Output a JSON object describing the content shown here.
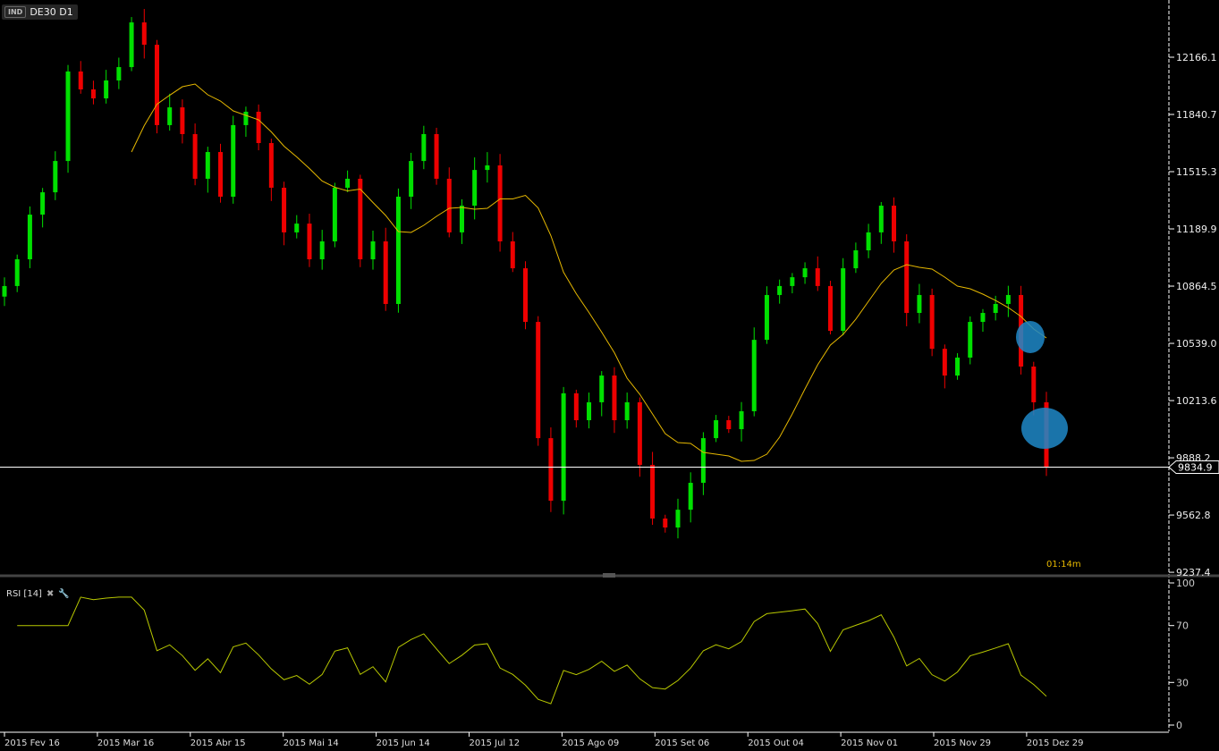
{
  "header": {
    "badge": "IND",
    "symbol": "DE30 D1"
  },
  "colors": {
    "up": "#00e000",
    "down": "#ee0000",
    "ma": "#e6b800",
    "rsi": "#b8c800",
    "annotation": "#1e88c8",
    "axis": "#ffffff"
  },
  "timer": "01:14m",
  "rsi_panel": {
    "label": "RSI [14]",
    "close_icon": "close-icon",
    "settings_icon": "wrench-icon",
    "ticks": [
      "100",
      "70",
      "30",
      "0"
    ]
  },
  "chart_data": {
    "type": "candlestick",
    "title": "DE30 D1",
    "price_ticks": [
      "12166.1",
      "11840.7",
      "11515.3",
      "11189.9",
      "10864.5",
      "10539.0",
      "10213.6",
      "9888.2",
      "9562.8",
      "9237.4"
    ],
    "ylim": [
      9237.4,
      12480
    ],
    "current_price": "9834.9",
    "date_ticks": [
      "2015 Fev 16",
      "2015 Mar 16",
      "2015 Abr 15",
      "2015 Mai 14",
      "2015 Jun 14",
      "2015 Jul 12",
      "2015 Ago 09",
      "2015 Set 06",
      "2015 Out 04",
      "2015 Nov 01",
      "2015 Nov 29",
      "2015 Dez 29"
    ],
    "closes": [
      10865,
      11017,
      11271,
      11398,
      11576,
      12085,
      11983,
      11932,
      12034,
      12110,
      12364,
      12237,
      11780,
      11881,
      11729,
      11475,
      11627,
      11373,
      11780,
      11856,
      11678,
      11424,
      11170,
      11220,
      11017,
      11119,
      11424,
      11475,
      11017,
      11119,
      10763,
      11373,
      11576,
      11729,
      11475,
      11170,
      11322,
      11525,
      11551,
      11119,
      10966,
      10661,
      10000,
      9644,
      10255,
      10102,
      10204,
      10356,
      10102,
      10204,
      9848,
      9543,
      9492,
      9593,
      9746,
      10000,
      10102,
      10051,
      10153,
      10559,
      10814,
      10865,
      10915,
      10966,
      10865,
      10610,
      10966,
      11068,
      11170,
      11322,
      11119,
      10712,
      10814,
      10508,
      10356,
      10458,
      10661,
      10712,
      10763,
      10814,
      10407,
      10204,
      9834.9
    ],
    "indicators": [
      "moving-average",
      "RSI 14"
    ],
    "annotations": [
      "blue-circle",
      "blue-circle"
    ]
  }
}
